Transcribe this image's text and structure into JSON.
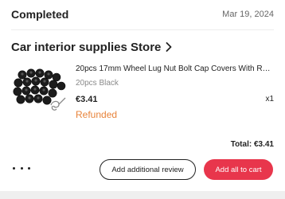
{
  "order": {
    "status": "Completed",
    "date": "Mar 19, 2024"
  },
  "store": {
    "name": "Car interior supplies Store",
    "chevron_icon": "chevron-right-icon"
  },
  "product": {
    "image_icon": "wheel-lug-nut-caps-image",
    "title": "20pcs 17mm Wheel Lug Nut Bolt Cap Covers With Remov...",
    "variant": "20pcs Black",
    "price": "€3.41",
    "quantity": "x1",
    "status": "Refunded",
    "status_color": "#e8833a"
  },
  "summary": {
    "total_label": "Total:",
    "total_value": "€3.41"
  },
  "actions": {
    "more_icon": "more-dots-icon",
    "review_label": "Add additional review",
    "cart_label": "Add all to cart",
    "cart_color": "#e8364c"
  }
}
